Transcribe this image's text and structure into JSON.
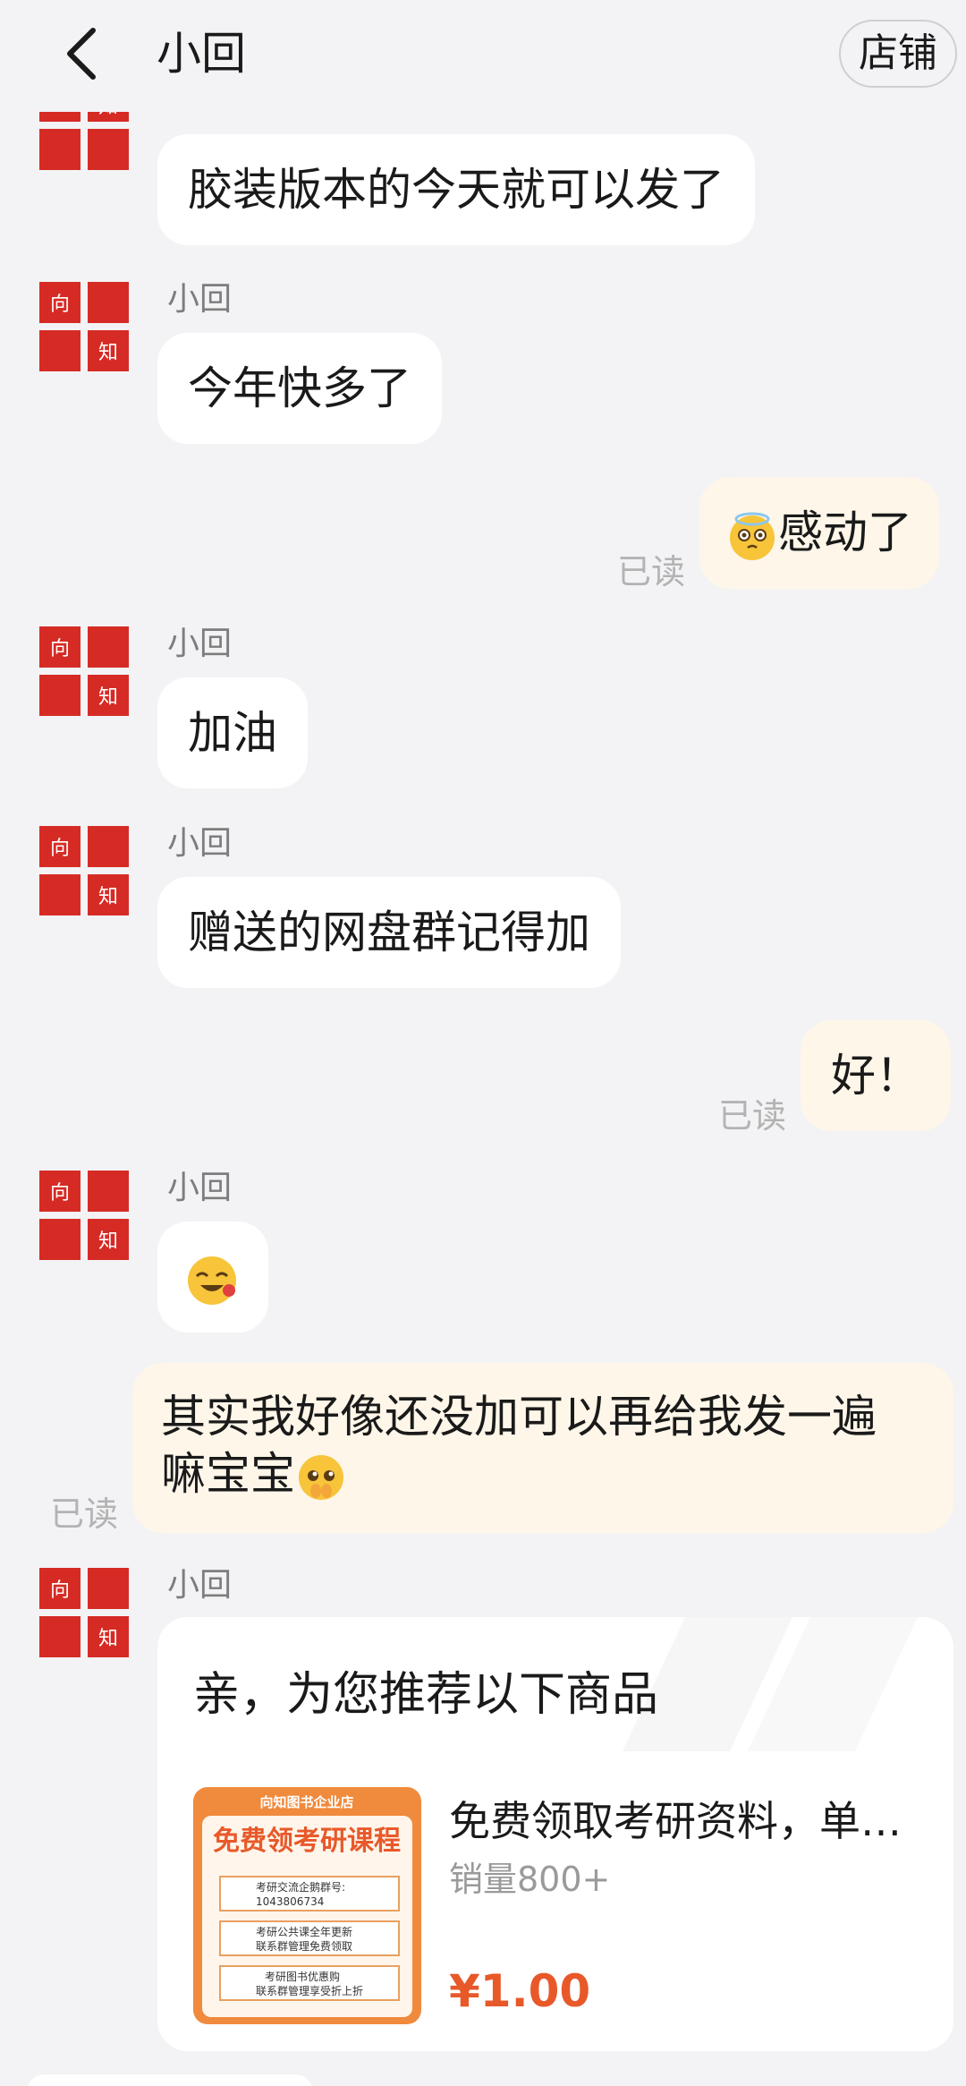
{
  "header": {
    "title": "小回",
    "shop_label": "店铺"
  },
  "avatar": {
    "seal_chars": [
      "向",
      "知"
    ]
  },
  "messages": [
    {
      "text": "胶装版本的今天就可以发了"
    },
    {
      "sender": "小回",
      "text": "今年快多了"
    },
    {
      "text": "感动了",
      "read": "已读",
      "emoji": "moved-face-emoji"
    },
    {
      "sender": "小回",
      "text": "加油"
    },
    {
      "sender": "小回",
      "text": "赠送的网盘群记得加"
    },
    {
      "text": "好！",
      "read": "已读"
    },
    {
      "sender": "小回",
      "emoji": "laughing-face-emoji"
    },
    {
      "line1": "其实我好像还没加可以再给我发一遍",
      "line2": "嘛宝宝",
      "read": "已读",
      "emoji": "pleading-face-emoji"
    },
    {
      "sender": "小回"
    }
  ],
  "card": {
    "heading": "亲，为您推荐以下商品",
    "product_title": "免费领取考研资料，单…",
    "sales": "销量800+",
    "price": "¥1.00",
    "thumb": {
      "store": "向知图书企业店",
      "headline": "免费领考研课程",
      "box1_line1": "考研交流企鹅群号:",
      "box1_line2": "1043806734",
      "box2_line1": "考研公共课全年更新",
      "box2_line2": "联系群管理免费领取",
      "box3_line1": "考研图书优惠购",
      "box3_line2": "联系群管理享受折上折"
    }
  },
  "colors": {
    "seal_red": "#d62b25",
    "price": "#e8592a",
    "out_bubble": "#fdf6e9"
  }
}
